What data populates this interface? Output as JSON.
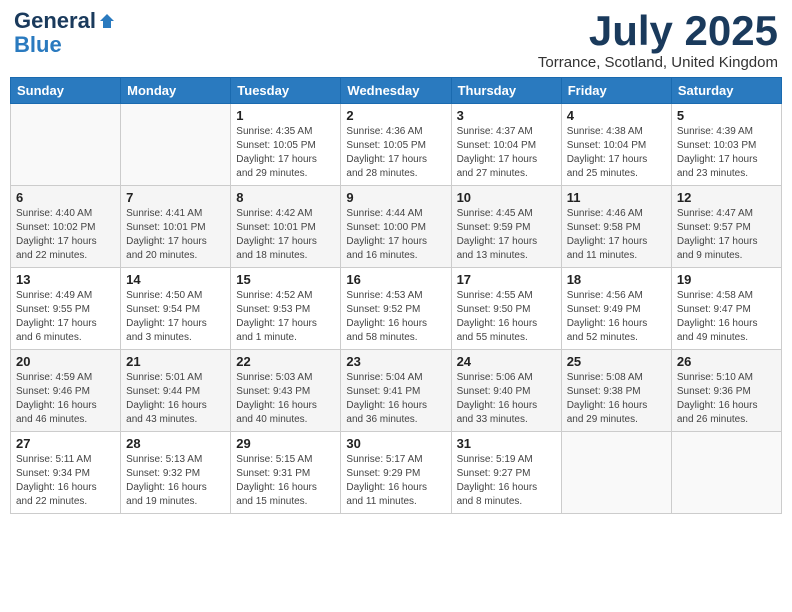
{
  "logo": {
    "general": "General",
    "blue": "Blue"
  },
  "header": {
    "month": "July 2025",
    "location": "Torrance, Scotland, United Kingdom"
  },
  "days_of_week": [
    "Sunday",
    "Monday",
    "Tuesday",
    "Wednesday",
    "Thursday",
    "Friday",
    "Saturday"
  ],
  "weeks": [
    [
      {
        "day": "",
        "sunrise": "",
        "sunset": "",
        "daylight": ""
      },
      {
        "day": "",
        "sunrise": "",
        "sunset": "",
        "daylight": ""
      },
      {
        "day": "1",
        "sunrise": "Sunrise: 4:35 AM",
        "sunset": "Sunset: 10:05 PM",
        "daylight": "Daylight: 17 hours and 29 minutes."
      },
      {
        "day": "2",
        "sunrise": "Sunrise: 4:36 AM",
        "sunset": "Sunset: 10:05 PM",
        "daylight": "Daylight: 17 hours and 28 minutes."
      },
      {
        "day": "3",
        "sunrise": "Sunrise: 4:37 AM",
        "sunset": "Sunset: 10:04 PM",
        "daylight": "Daylight: 17 hours and 27 minutes."
      },
      {
        "day": "4",
        "sunrise": "Sunrise: 4:38 AM",
        "sunset": "Sunset: 10:04 PM",
        "daylight": "Daylight: 17 hours and 25 minutes."
      },
      {
        "day": "5",
        "sunrise": "Sunrise: 4:39 AM",
        "sunset": "Sunset: 10:03 PM",
        "daylight": "Daylight: 17 hours and 23 minutes."
      }
    ],
    [
      {
        "day": "6",
        "sunrise": "Sunrise: 4:40 AM",
        "sunset": "Sunset: 10:02 PM",
        "daylight": "Daylight: 17 hours and 22 minutes."
      },
      {
        "day": "7",
        "sunrise": "Sunrise: 4:41 AM",
        "sunset": "Sunset: 10:01 PM",
        "daylight": "Daylight: 17 hours and 20 minutes."
      },
      {
        "day": "8",
        "sunrise": "Sunrise: 4:42 AM",
        "sunset": "Sunset: 10:01 PM",
        "daylight": "Daylight: 17 hours and 18 minutes."
      },
      {
        "day": "9",
        "sunrise": "Sunrise: 4:44 AM",
        "sunset": "Sunset: 10:00 PM",
        "daylight": "Daylight: 17 hours and 16 minutes."
      },
      {
        "day": "10",
        "sunrise": "Sunrise: 4:45 AM",
        "sunset": "Sunset: 9:59 PM",
        "daylight": "Daylight: 17 hours and 13 minutes."
      },
      {
        "day": "11",
        "sunrise": "Sunrise: 4:46 AM",
        "sunset": "Sunset: 9:58 PM",
        "daylight": "Daylight: 17 hours and 11 minutes."
      },
      {
        "day": "12",
        "sunrise": "Sunrise: 4:47 AM",
        "sunset": "Sunset: 9:57 PM",
        "daylight": "Daylight: 17 hours and 9 minutes."
      }
    ],
    [
      {
        "day": "13",
        "sunrise": "Sunrise: 4:49 AM",
        "sunset": "Sunset: 9:55 PM",
        "daylight": "Daylight: 17 hours and 6 minutes."
      },
      {
        "day": "14",
        "sunrise": "Sunrise: 4:50 AM",
        "sunset": "Sunset: 9:54 PM",
        "daylight": "Daylight: 17 hours and 3 minutes."
      },
      {
        "day": "15",
        "sunrise": "Sunrise: 4:52 AM",
        "sunset": "Sunset: 9:53 PM",
        "daylight": "Daylight: 17 hours and 1 minute."
      },
      {
        "day": "16",
        "sunrise": "Sunrise: 4:53 AM",
        "sunset": "Sunset: 9:52 PM",
        "daylight": "Daylight: 16 hours and 58 minutes."
      },
      {
        "day": "17",
        "sunrise": "Sunrise: 4:55 AM",
        "sunset": "Sunset: 9:50 PM",
        "daylight": "Daylight: 16 hours and 55 minutes."
      },
      {
        "day": "18",
        "sunrise": "Sunrise: 4:56 AM",
        "sunset": "Sunset: 9:49 PM",
        "daylight": "Daylight: 16 hours and 52 minutes."
      },
      {
        "day": "19",
        "sunrise": "Sunrise: 4:58 AM",
        "sunset": "Sunset: 9:47 PM",
        "daylight": "Daylight: 16 hours and 49 minutes."
      }
    ],
    [
      {
        "day": "20",
        "sunrise": "Sunrise: 4:59 AM",
        "sunset": "Sunset: 9:46 PM",
        "daylight": "Daylight: 16 hours and 46 minutes."
      },
      {
        "day": "21",
        "sunrise": "Sunrise: 5:01 AM",
        "sunset": "Sunset: 9:44 PM",
        "daylight": "Daylight: 16 hours and 43 minutes."
      },
      {
        "day": "22",
        "sunrise": "Sunrise: 5:03 AM",
        "sunset": "Sunset: 9:43 PM",
        "daylight": "Daylight: 16 hours and 40 minutes."
      },
      {
        "day": "23",
        "sunrise": "Sunrise: 5:04 AM",
        "sunset": "Sunset: 9:41 PM",
        "daylight": "Daylight: 16 hours and 36 minutes."
      },
      {
        "day": "24",
        "sunrise": "Sunrise: 5:06 AM",
        "sunset": "Sunset: 9:40 PM",
        "daylight": "Daylight: 16 hours and 33 minutes."
      },
      {
        "day": "25",
        "sunrise": "Sunrise: 5:08 AM",
        "sunset": "Sunset: 9:38 PM",
        "daylight": "Daylight: 16 hours and 29 minutes."
      },
      {
        "day": "26",
        "sunrise": "Sunrise: 5:10 AM",
        "sunset": "Sunset: 9:36 PM",
        "daylight": "Daylight: 16 hours and 26 minutes."
      }
    ],
    [
      {
        "day": "27",
        "sunrise": "Sunrise: 5:11 AM",
        "sunset": "Sunset: 9:34 PM",
        "daylight": "Daylight: 16 hours and 22 minutes."
      },
      {
        "day": "28",
        "sunrise": "Sunrise: 5:13 AM",
        "sunset": "Sunset: 9:32 PM",
        "daylight": "Daylight: 16 hours and 19 minutes."
      },
      {
        "day": "29",
        "sunrise": "Sunrise: 5:15 AM",
        "sunset": "Sunset: 9:31 PM",
        "daylight": "Daylight: 16 hours and 15 minutes."
      },
      {
        "day": "30",
        "sunrise": "Sunrise: 5:17 AM",
        "sunset": "Sunset: 9:29 PM",
        "daylight": "Daylight: 16 hours and 11 minutes."
      },
      {
        "day": "31",
        "sunrise": "Sunrise: 5:19 AM",
        "sunset": "Sunset: 9:27 PM",
        "daylight": "Daylight: 16 hours and 8 minutes."
      },
      {
        "day": "",
        "sunrise": "",
        "sunset": "",
        "daylight": ""
      },
      {
        "day": "",
        "sunrise": "",
        "sunset": "",
        "daylight": ""
      }
    ]
  ]
}
